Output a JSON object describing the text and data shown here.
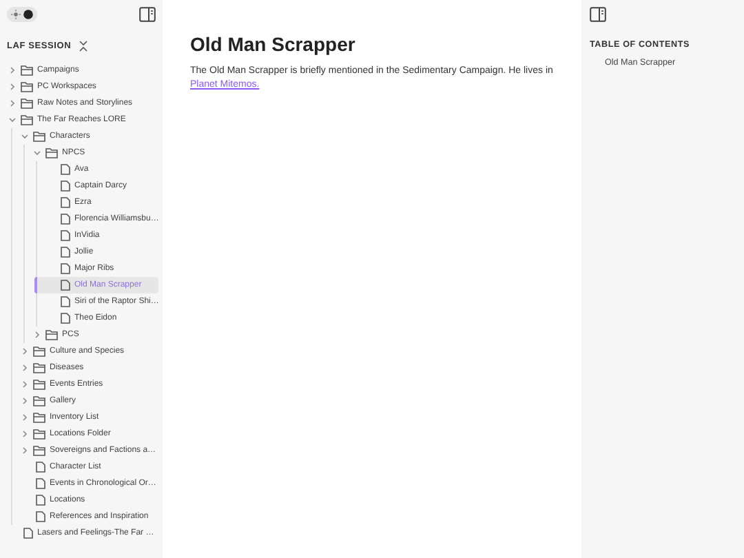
{
  "sidebar": {
    "theme_toggle": {
      "dark": true
    },
    "title": "LAF SESSION",
    "tree": [
      {
        "kind": "folder",
        "label": "Campaigns",
        "expanded": false,
        "selected": false
      },
      {
        "kind": "folder",
        "label": "PC Workspaces",
        "expanded": false,
        "selected": false
      },
      {
        "kind": "folder",
        "label": "Raw Notes and Storylines",
        "expanded": false,
        "selected": false
      },
      {
        "kind": "folder",
        "label": "The Far Reaches LORE",
        "expanded": true,
        "selected": false,
        "children": [
          {
            "kind": "folder",
            "label": "Characters",
            "expanded": true,
            "selected": false,
            "children": [
              {
                "kind": "folder",
                "label": "NPCS",
                "expanded": true,
                "selected": false,
                "children": [
                  {
                    "kind": "file",
                    "label": "Ava",
                    "selected": false
                  },
                  {
                    "kind": "file",
                    "label": "Captain Darcy",
                    "selected": false
                  },
                  {
                    "kind": "file",
                    "label": "Ezra",
                    "selected": false
                  },
                  {
                    "kind": "file",
                    "label": "Florencia Williamsbu…",
                    "selected": false
                  },
                  {
                    "kind": "file",
                    "label": "InVidia",
                    "selected": false
                  },
                  {
                    "kind": "file",
                    "label": "Jollie",
                    "selected": false
                  },
                  {
                    "kind": "file",
                    "label": "Major Ribs",
                    "selected": false
                  },
                  {
                    "kind": "file",
                    "label": "Old Man Scrapper",
                    "selected": true
                  },
                  {
                    "kind": "file",
                    "label": "Siri of the Raptor Shi…",
                    "selected": false
                  },
                  {
                    "kind": "file",
                    "label": "Theo Eidon",
                    "selected": false
                  }
                ]
              },
              {
                "kind": "folder",
                "label": "PCS",
                "expanded": false,
                "selected": false
              }
            ]
          },
          {
            "kind": "folder",
            "label": "Culture and Species",
            "expanded": false,
            "selected": false
          },
          {
            "kind": "folder",
            "label": "Diseases",
            "expanded": false,
            "selected": false
          },
          {
            "kind": "folder",
            "label": "Events Entries",
            "expanded": false,
            "selected": false
          },
          {
            "kind": "folder",
            "label": "Gallery",
            "expanded": false,
            "selected": false
          },
          {
            "kind": "folder",
            "label": "Inventory List",
            "expanded": false,
            "selected": false
          },
          {
            "kind": "folder",
            "label": "Locations Folder",
            "expanded": false,
            "selected": false
          },
          {
            "kind": "folder",
            "label": "Sovereigns and Factions a…",
            "expanded": false,
            "selected": false
          },
          {
            "kind": "file",
            "label": "Character List",
            "selected": false
          },
          {
            "kind": "file",
            "label": "Events in Chronological Or…",
            "selected": false
          },
          {
            "kind": "file",
            "label": "Locations",
            "selected": false
          },
          {
            "kind": "file",
            "label": "References and Inspiration",
            "selected": false
          }
        ]
      },
      {
        "kind": "file",
        "label": "Lasers and Feelings-The Far …",
        "selected": false
      }
    ]
  },
  "article": {
    "title": "Old Man Scrapper",
    "text": "The Old Man Scrapper is briefly mentioned in the Sedimentary Campaign. He lives in",
    "link": "Planet Mitemos."
  },
  "toc": {
    "title": "TABLE OF CONTENTS",
    "items": [
      "Old Man Scrapper"
    ]
  }
}
